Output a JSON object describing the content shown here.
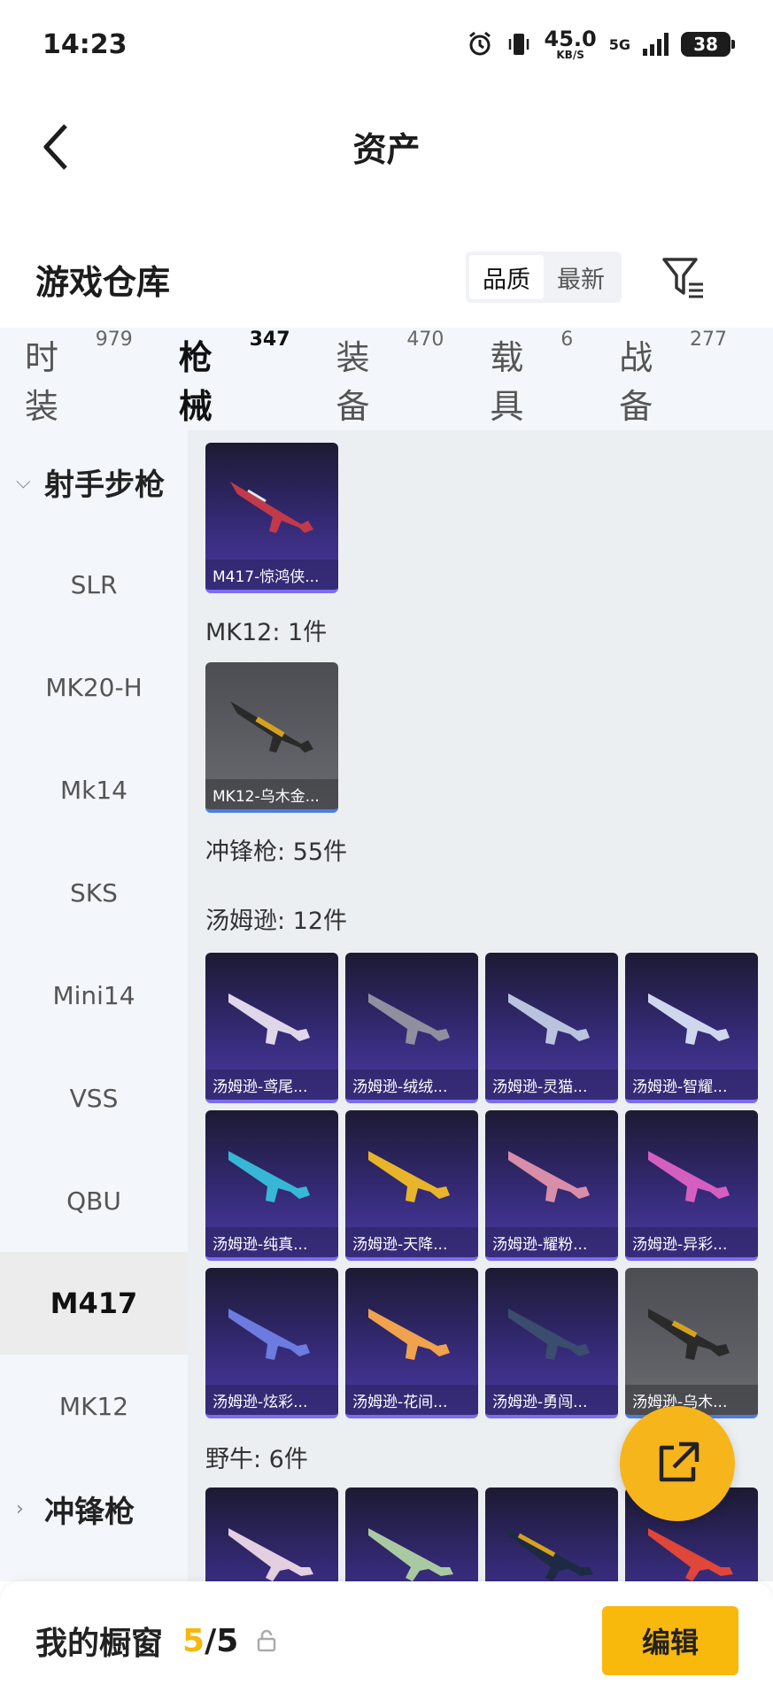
{
  "status_bar": {
    "time": "14:23",
    "speed_value": "45.0",
    "speed_unit": "KB/S",
    "network": "5G",
    "battery": "38"
  },
  "nav": {
    "title": "资产"
  },
  "warehouse": {
    "title": "游戏仓库",
    "sort_options": [
      "品质",
      "最新"
    ]
  },
  "tabs": [
    {
      "label": "时装",
      "count": "979"
    },
    {
      "label": "枪械",
      "count": "347"
    },
    {
      "label": "装备",
      "count": "470"
    },
    {
      "label": "载具",
      "count": "6"
    },
    {
      "label": "战备",
      "count": "277"
    }
  ],
  "sidebar": {
    "group_1": "射手步枪",
    "items": [
      "SLR",
      "MK20-H",
      "Mk14",
      "SKS",
      "Mini14",
      "VSS",
      "QBU",
      "M417",
      "MK12"
    ],
    "group_2": "冲锋枪"
  },
  "content": {
    "m417_items": [
      {
        "name": "M417-惊鸿侠..."
      }
    ],
    "mk12_label": "MK12: 1件",
    "mk12_items": [
      {
        "name": "MK12-乌木金..."
      }
    ],
    "smg_label": "冲锋枪: 55件",
    "tommy_label": "汤姆逊: 12件",
    "tommy_items": [
      {
        "name": "汤姆逊-鸢尾..."
      },
      {
        "name": "汤姆逊-绒绒..."
      },
      {
        "name": "汤姆逊-灵猫..."
      },
      {
        "name": "汤姆逊-智耀..."
      },
      {
        "name": "汤姆逊-纯真..."
      },
      {
        "name": "汤姆逊-天降..."
      },
      {
        "name": "汤姆逊-耀粉..."
      },
      {
        "name": "汤姆逊-异彩..."
      },
      {
        "name": "汤姆逊-炫彩..."
      },
      {
        "name": "汤姆逊-花间..."
      },
      {
        "name": "汤姆逊-勇闯..."
      },
      {
        "name": "汤姆逊-乌木..."
      }
    ],
    "bison_label": "野牛: 6件"
  },
  "bottom_bar": {
    "label": "我的橱窗",
    "count_current": "5",
    "count_sep": "/",
    "count_total": "5",
    "edit_label": "编辑"
  }
}
